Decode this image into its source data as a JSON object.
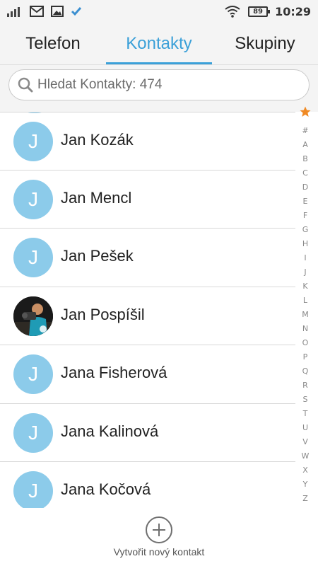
{
  "status_bar": {
    "time": "10:29",
    "battery": "89",
    "icons": [
      "signal-icon",
      "gmail-icon",
      "gallery-icon",
      "check-icon",
      "wifi-icon",
      "battery-icon"
    ]
  },
  "tabs": [
    {
      "label": "Telefon",
      "active": false
    },
    {
      "label": "Kontakty",
      "active": true
    },
    {
      "label": "Skupiny",
      "active": false
    }
  ],
  "search": {
    "placeholder": "Hledat Kontakty: 474"
  },
  "contacts": [
    {
      "name": "Jan Kozák",
      "initial": "J",
      "has_photo": false
    },
    {
      "name": "Jan Mencl",
      "initial": "J",
      "has_photo": false
    },
    {
      "name": "Jan Pešek",
      "initial": "J",
      "has_photo": false
    },
    {
      "name": "Jan Pospíšil",
      "initial": "",
      "has_photo": true
    },
    {
      "name": "Jana Fisherová",
      "initial": "J",
      "has_photo": false
    },
    {
      "name": "Jana Kalinová",
      "initial": "J",
      "has_photo": false
    },
    {
      "name": "Jana Kočová",
      "initial": "J",
      "has_photo": false
    }
  ],
  "index_letters": [
    "#",
    "A",
    "B",
    "C",
    "D",
    "E",
    "F",
    "G",
    "H",
    "I",
    "J",
    "K",
    "L",
    "M",
    "N",
    "O",
    "P",
    "Q",
    "R",
    "S",
    "T",
    "U",
    "V",
    "W",
    "X",
    "Y",
    "Z"
  ],
  "bottom": {
    "add_label": "Vytvořit nový kontakt"
  },
  "colors": {
    "accent": "#3ba0d8",
    "avatar": "#8ccbea",
    "favorite_star": "#f08a24"
  }
}
